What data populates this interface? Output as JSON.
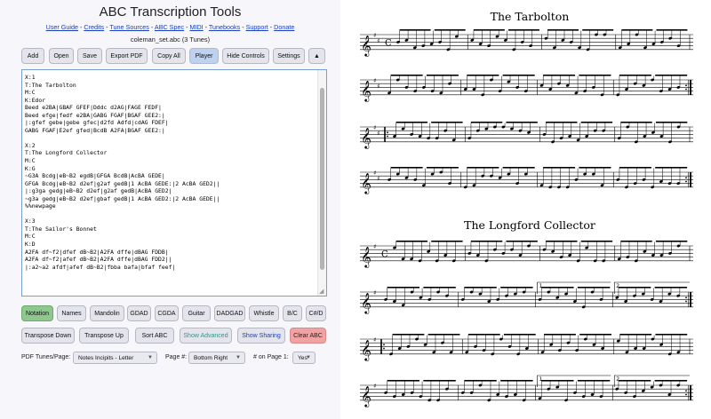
{
  "app": {
    "title": "ABC Transcription Tools",
    "links": [
      "User Guide",
      "Credits",
      "Tune Sources",
      "ABC Spec",
      "MIDI",
      "Tunebooks",
      "Support",
      "Donate"
    ],
    "filename": "coleman_set.abc (3 Tunes)"
  },
  "toolbar": {
    "add": "Add",
    "open": "Open",
    "save": "Save",
    "export_pdf": "Export PDF",
    "copy_all": "Copy All",
    "player": "Player",
    "hide_controls": "Hide Controls",
    "settings": "Settings",
    "collapse": "▲"
  },
  "editor": {
    "lines": [
      "X:1",
      "T:The Tarbolton",
      "M:C",
      "K:Edor",
      "Beed e2BA|GBAF GFEF|Dddc d2AG|FAGE FEDF|",
      "Beed efge|fedf e2BA|GABG FGAF|BGAF GEE2:|",
      "|:gfef gebe|gebe gfec|d2fd Adfd|cdAG FDEF|",
      "GABG FGAF|E2ef gfed|BcdB A2FA|BGAF GEE2:|",
      "",
      "X:2",
      "T:The Longford Collector",
      "M:C",
      "K:G",
      "~G3A Bcdg|eB~B2 egdB|GFGA BcdB|AcBA GEDE|",
      "GFGA Bcdg|eB~B2 d2ef|g2af gedB|1 AcBA GEDE:|2 AcBA GED2||",
      "|:g3ga gedg|eB~B2 d2ef|g2af gedB|AcBA GED2|",
      "~g3a gedg|eB~B2 d2ef|gbaf gedB|1 AcBA GED2:|2 AcBA GEDE||",
      "%%newpage",
      "",
      "X:3",
      "T:The Sailor's Bonnet",
      "M:C",
      "K:D",
      "A2FA df~f2|dfef dB~B2|A2FA dffe|dBAG FDDB|",
      "A2FA df~f2|afef dB~B2|A2FA dffe|dBAG FDD2||",
      "|:a2~a2 afdf|afef dB~B2|fbba bafa|bfaf feef|"
    ]
  },
  "tabs": {
    "notation": "Notation",
    "names": "Names",
    "mandolin": "Mandolin",
    "gdad": "GDAD",
    "cgda": "CGDA",
    "guitar": "Guitar",
    "dadgad": "DADGAD",
    "whistle": "Whistle",
    "bc": "B/C",
    "csd": "C#/D"
  },
  "actions": {
    "transpose_down": "Transpose Down",
    "transpose_up": "Transpose Up",
    "sort_abc": "Sort ABC",
    "show_advanced": "Show Advanced",
    "show_sharing": "Show Sharing",
    "clear_abc": "Clear ABC"
  },
  "pdf": {
    "tunes_label": "PDF Tunes/Page:",
    "tunes_value": "Notes Incipits - Letter",
    "page_label": "Page #:",
    "page_value": "Bottom Right",
    "on_page_label": "# on Page 1:",
    "on_page_value": "Yes"
  },
  "score": {
    "tune1_title": "The Tarbolton",
    "tune2_title": "The Longford Collector",
    "ending1": "1",
    "ending2": "2"
  }
}
